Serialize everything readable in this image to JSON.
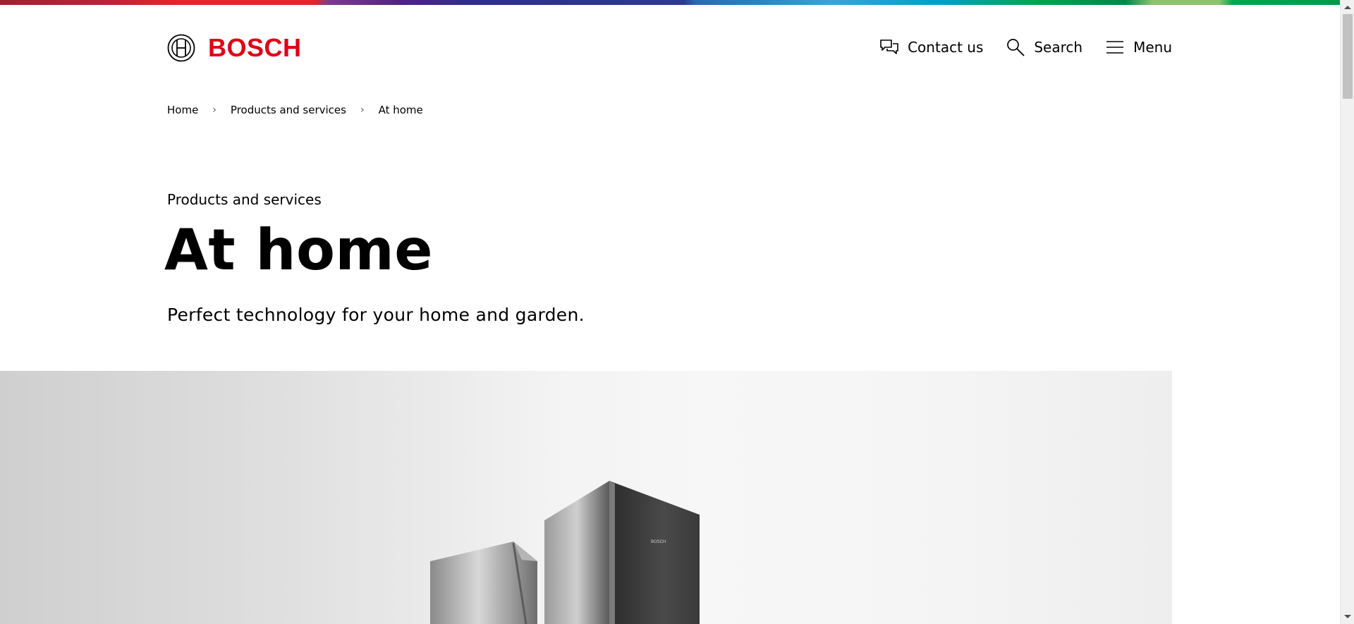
{
  "brand": {
    "name": "BOSCH",
    "color": "#e20015"
  },
  "nav": {
    "contact_label": "Contact us",
    "search_label": "Search",
    "menu_label": "Menu"
  },
  "breadcrumb": [
    "Home",
    "Products and services",
    "At home"
  ],
  "hero_text": {
    "eyebrow": "Products and services",
    "title": "At home",
    "lead": "Perfect technology for your home and garden."
  },
  "hero_image": {
    "device_label": "BOSCH"
  }
}
